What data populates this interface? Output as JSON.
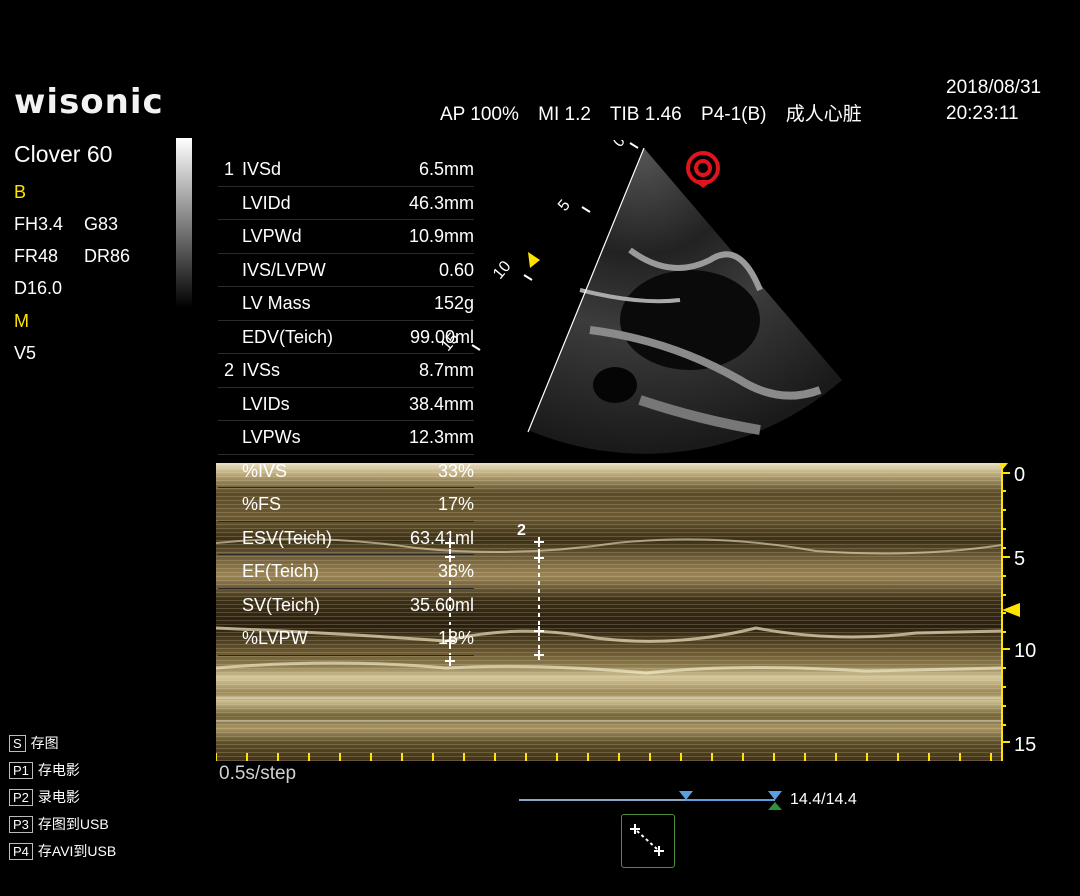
{
  "header": {
    "logo": "wisonic",
    "params": [
      "AP 100%",
      "MI 1.2",
      "TIB 1.46",
      "P4-1(B)",
      "成人心脏"
    ],
    "date": "2018/08/31",
    "time": "20:23:11"
  },
  "left": {
    "model": "Clover 60",
    "b_label": "B",
    "b_params": [
      "FH3.4",
      "G83",
      "FR48",
      "DR86",
      "D16.0"
    ],
    "m_label": "M",
    "m_params": [
      "V5"
    ]
  },
  "measurements": [
    {
      "num": "1",
      "name": "IVSd",
      "value": "6.5mm"
    },
    {
      "num": "",
      "name": "LVIDd",
      "value": "46.3mm"
    },
    {
      "num": "",
      "name": "LVPWd",
      "value": "10.9mm"
    },
    {
      "num": "",
      "name": "IVS/LVPW",
      "value": "0.60"
    },
    {
      "num": "",
      "name": "LV Mass",
      "value": "152g"
    },
    {
      "num": "",
      "name": "EDV(Teich)",
      "value": "99.00ml"
    },
    {
      "num": "2",
      "name": "IVSs",
      "value": "8.7mm"
    },
    {
      "num": "",
      "name": "LVIDs",
      "value": "38.4mm"
    },
    {
      "num": "",
      "name": "LVPWs",
      "value": "12.3mm"
    },
    {
      "num": "",
      "name": "%IVS",
      "value": "33%"
    },
    {
      "num": "",
      "name": "%FS",
      "value": "17%"
    },
    {
      "num": "",
      "name": "ESV(Teich)",
      "value": "63.41ml"
    },
    {
      "num": "",
      "name": "EF(Teich)",
      "value": "36%"
    },
    {
      "num": "",
      "name": "SV(Teich)",
      "value": "35.60ml"
    },
    {
      "num": "",
      "name": "%LVPW",
      "value": "18%"
    }
  ],
  "sector_scale": [
    "0",
    "5",
    "10",
    "15"
  ],
  "mmode": {
    "depth_labels": [
      "0",
      "5",
      "10",
      "15"
    ],
    "step_label": "0.5s/step",
    "marker2_label": "2"
  },
  "shortcuts": [
    {
      "key": "S",
      "label": "存图"
    },
    {
      "key": "P1",
      "label": "存电影"
    },
    {
      "key": "P2",
      "label": "录电影"
    },
    {
      "key": "P3",
      "label": "存图到USB"
    },
    {
      "key": "P4",
      "label": "存AVI到USB"
    }
  ],
  "cine": {
    "frame_label": "14.4/14.4"
  },
  "colors": {
    "accent_yellow": "#ffe400",
    "probe_red": "#e0141c",
    "slider_blue": "#5aa0e0"
  },
  "icons": [
    "probe-orientation-icon",
    "caliper-tool-icon",
    "focus-marker-icon"
  ]
}
